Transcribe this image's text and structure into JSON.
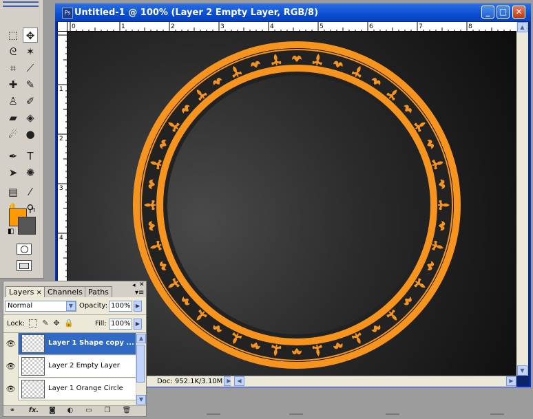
{
  "document": {
    "title": "Untitled-1 @ 100% (Layer 2 Empty Layer, RGB/8)",
    "app_badge": "Ps",
    "status": "Doc: 952.1K/3.10M",
    "ruler_top_labels": [
      "0",
      "1",
      "2",
      "3",
      "4",
      "5",
      "6",
      "7",
      "8"
    ],
    "ruler_left_labels": [
      "1",
      "2",
      "3",
      "4"
    ]
  },
  "window_controls": {
    "minimize": "_",
    "maximize": "□",
    "close": "✕"
  },
  "toolbox": {
    "foreground_color": "#ff9a00",
    "background_color": "#555555",
    "tools": [
      {
        "name": "marquee-icon",
        "glyph": "⬚"
      },
      {
        "name": "move-icon",
        "glyph": "✥"
      },
      {
        "name": "lasso-icon",
        "glyph": "ᘓ"
      },
      {
        "name": "magic-wand-icon",
        "glyph": "✶"
      },
      {
        "name": "crop-icon",
        "glyph": "⌗"
      },
      {
        "name": "slice-icon",
        "glyph": "⟋"
      },
      {
        "name": "healing-brush-icon",
        "glyph": "✚"
      },
      {
        "name": "brush-icon",
        "glyph": "✎"
      },
      {
        "name": "clone-stamp-icon",
        "glyph": "♙"
      },
      {
        "name": "history-brush-icon",
        "glyph": "✐"
      },
      {
        "name": "eraser-icon",
        "glyph": "▰"
      },
      {
        "name": "paint-bucket-icon",
        "glyph": "◈"
      },
      {
        "name": "blur-icon",
        "glyph": "☄"
      },
      {
        "name": "dodge-icon",
        "glyph": "●"
      },
      {
        "name": "pen-icon",
        "glyph": "✒"
      },
      {
        "name": "type-icon",
        "glyph": "T"
      },
      {
        "name": "path-selection-icon",
        "glyph": "➤"
      },
      {
        "name": "custom-shape-icon",
        "glyph": "✺"
      },
      {
        "name": "notes-icon",
        "glyph": "▤"
      },
      {
        "name": "eyedropper-icon",
        "glyph": "⁄"
      },
      {
        "name": "hand-icon",
        "glyph": "✋"
      },
      {
        "name": "zoom-icon",
        "glyph": "⚲"
      }
    ]
  },
  "layers_panel": {
    "tabs": [
      {
        "label": "Layers",
        "active": true
      },
      {
        "label": "Channels",
        "active": false
      },
      {
        "label": "Paths",
        "active": false
      }
    ],
    "tab_close": "✕",
    "blend_mode": "Normal",
    "opacity_label": "Opacity:",
    "opacity_value": "100%",
    "lock_label": "Lock:",
    "fill_label": "Fill:",
    "fill_value": "100%",
    "layers": [
      {
        "name": "Layer 1 Shape copy ...",
        "selected": true
      },
      {
        "name": "Layer 2 Empty Layer",
        "selected": false
      },
      {
        "name": "Layer 1 Orange Circle",
        "selected": false
      }
    ],
    "footer_buttons": [
      {
        "name": "link-layers-icon",
        "glyph": "⚭"
      },
      {
        "name": "fx-icon",
        "glyph": "fx."
      },
      {
        "name": "layer-mask-icon",
        "glyph": "◙"
      },
      {
        "name": "adjustment-layer-icon",
        "glyph": "◐"
      },
      {
        "name": "new-group-icon",
        "glyph": "▭"
      },
      {
        "name": "new-layer-icon",
        "glyph": "❐"
      },
      {
        "name": "delete-layer-icon",
        "glyph": "🗑"
      }
    ]
  },
  "colors": {
    "ornament": "#f7941d",
    "ring_inner": "#222222"
  }
}
